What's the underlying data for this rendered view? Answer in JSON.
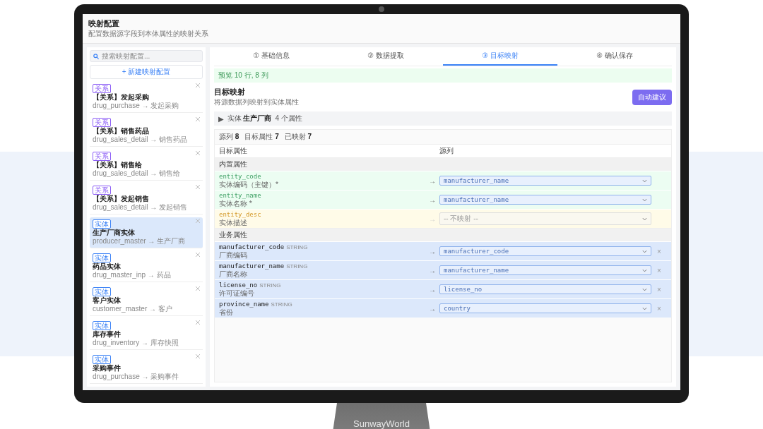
{
  "page": {
    "title": "映射配置",
    "subtitle": "配置数据源字段到本体属性的映射关系"
  },
  "sidebar": {
    "search": {
      "placeholder": "搜索映射配置..."
    },
    "new_button": "+ 新建映射配置",
    "items": [
      {
        "tag": "关系",
        "color": "#8b5cf6",
        "title": "【关系】发起采购",
        "source": "drug_purchase → 发起采购",
        "selected": false
      },
      {
        "tag": "关系",
        "color": "#8b5cf6",
        "title": "【关系】销售药品",
        "source": "drug_sales_detail → 销售药品",
        "selected": false
      },
      {
        "tag": "关系",
        "color": "#8b5cf6",
        "title": "【关系】销售给",
        "source": "drug_sales_detail → 销售给",
        "selected": false
      },
      {
        "tag": "关系",
        "color": "#8b5cf6",
        "title": "【关系】发起销售",
        "source": "drug_sales_detail → 发起销售",
        "selected": false
      },
      {
        "tag": "实体",
        "color": "#3b82f6",
        "title": "生产厂商实体",
        "source": "producer_master → 生产厂商",
        "selected": true
      },
      {
        "tag": "实体",
        "color": "#3b82f6",
        "title": "药品实体",
        "source": "drug_master_inp → 药品",
        "selected": false
      },
      {
        "tag": "实体",
        "color": "#3b82f6",
        "title": "客户实体",
        "source": "customer_master → 客户",
        "selected": false
      },
      {
        "tag": "实体",
        "color": "#3b82f6",
        "title": "库存事件",
        "source": "drug_inventory → 库存快照",
        "selected": false
      },
      {
        "tag": "实体",
        "color": "#3b82f6",
        "title": "采购事件",
        "source": "drug_purchase → 采购事件",
        "selected": false
      }
    ]
  },
  "steps": [
    {
      "label": "① 基础信息",
      "selected": false
    },
    {
      "label": "② 数据提取",
      "selected": false
    },
    {
      "label": "③ 目标映射",
      "selected": true
    },
    {
      "label": "④ 确认保存",
      "selected": false
    }
  ],
  "preview_notice": "预览 10 行, 8 列",
  "mapping": {
    "title": "目标映射",
    "subtitle": "将源数据列映射到实体属性",
    "auto_button": "自动建议",
    "entity": {
      "toggle": "▶",
      "prefix": "实体",
      "name": "生产厂商",
      "count": "4 个属性"
    },
    "stats": [
      {
        "label": "源列",
        "value": "8"
      },
      {
        "label": "目标属性",
        "value": "7"
      },
      {
        "label": "已映射",
        "value": "7"
      }
    ],
    "columns": [
      "目标属性",
      "源列"
    ],
    "groups": [
      {
        "title": "内置属性",
        "rows": [
          {
            "kind": "builtin",
            "mapped": true,
            "name": "entity_code",
            "label": "实体编码（主键）*",
            "arrow": "→",
            "source": "manufacturer_name"
          },
          {
            "kind": "builtin",
            "mapped": true,
            "name": "entity_name",
            "label": "实体名称 *",
            "arrow": "→",
            "source": "manufacturer_name"
          },
          {
            "kind": "builtin",
            "mapped": false,
            "name": "entity_desc",
            "label": "实体描述",
            "arrow": "→",
            "source": "-- 不映射 --"
          }
        ]
      },
      {
        "title": "业务属性",
        "rows": [
          {
            "kind": "business",
            "mapped": true,
            "name": "manufacturer_code",
            "type": "STRING",
            "label": "厂商编码",
            "arrow": "→",
            "source": "manufacturer_code",
            "remove": "×"
          },
          {
            "kind": "business",
            "mapped": true,
            "name": "manufacturer_name",
            "type": "STRING",
            "label": "厂商名称",
            "arrow": "→",
            "source": "manufacturer_name",
            "remove": "×"
          },
          {
            "kind": "business",
            "mapped": true,
            "name": "license_no",
            "type": "STRING",
            "label": "许可证编号",
            "arrow": "→",
            "source": "license_no",
            "remove": "×"
          },
          {
            "kind": "business",
            "mapped": true,
            "name": "province_name",
            "type": "STRING",
            "label": "省份",
            "arrow": "→",
            "source": "country",
            "remove": "×"
          }
        ]
      }
    ]
  },
  "monitor": {
    "brand": "SunwayWorld"
  }
}
